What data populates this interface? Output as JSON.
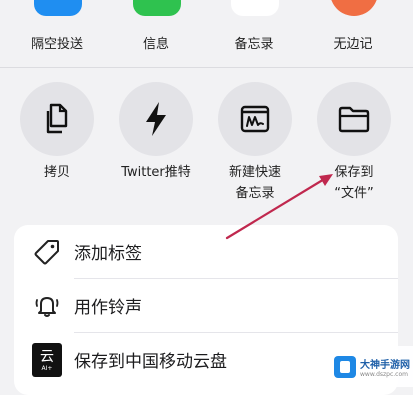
{
  "apps": [
    {
      "label": "隔空投送",
      "color": "#1f8ef1"
    },
    {
      "label": "信息",
      "color": "#2fc24f"
    },
    {
      "label": "备忘录",
      "color": "#ffffff"
    },
    {
      "label": "无边记",
      "color": "#f06e43"
    }
  ],
  "actions": [
    {
      "label": "拷贝",
      "icon": "copy-icon"
    },
    {
      "label": "Twitter推特",
      "icon": "lightning-icon"
    },
    {
      "label": "新建快速\n备忘录",
      "icon": "quick-note-icon"
    },
    {
      "label": "保存到\n“文件”",
      "icon": "folder-icon"
    }
  ],
  "menu": {
    "add_tag": "添加标签",
    "ringtone": "用作铃声",
    "save_mobile_cloud": "保存到中国移动云盘",
    "cloud_logo_char": "云",
    "cloud_logo_sub": "AI+"
  },
  "annotation": {
    "arrow_color": "#c0284e"
  },
  "watermark": {
    "title": "大神手游网",
    "url": "www.dszpc.com"
  }
}
